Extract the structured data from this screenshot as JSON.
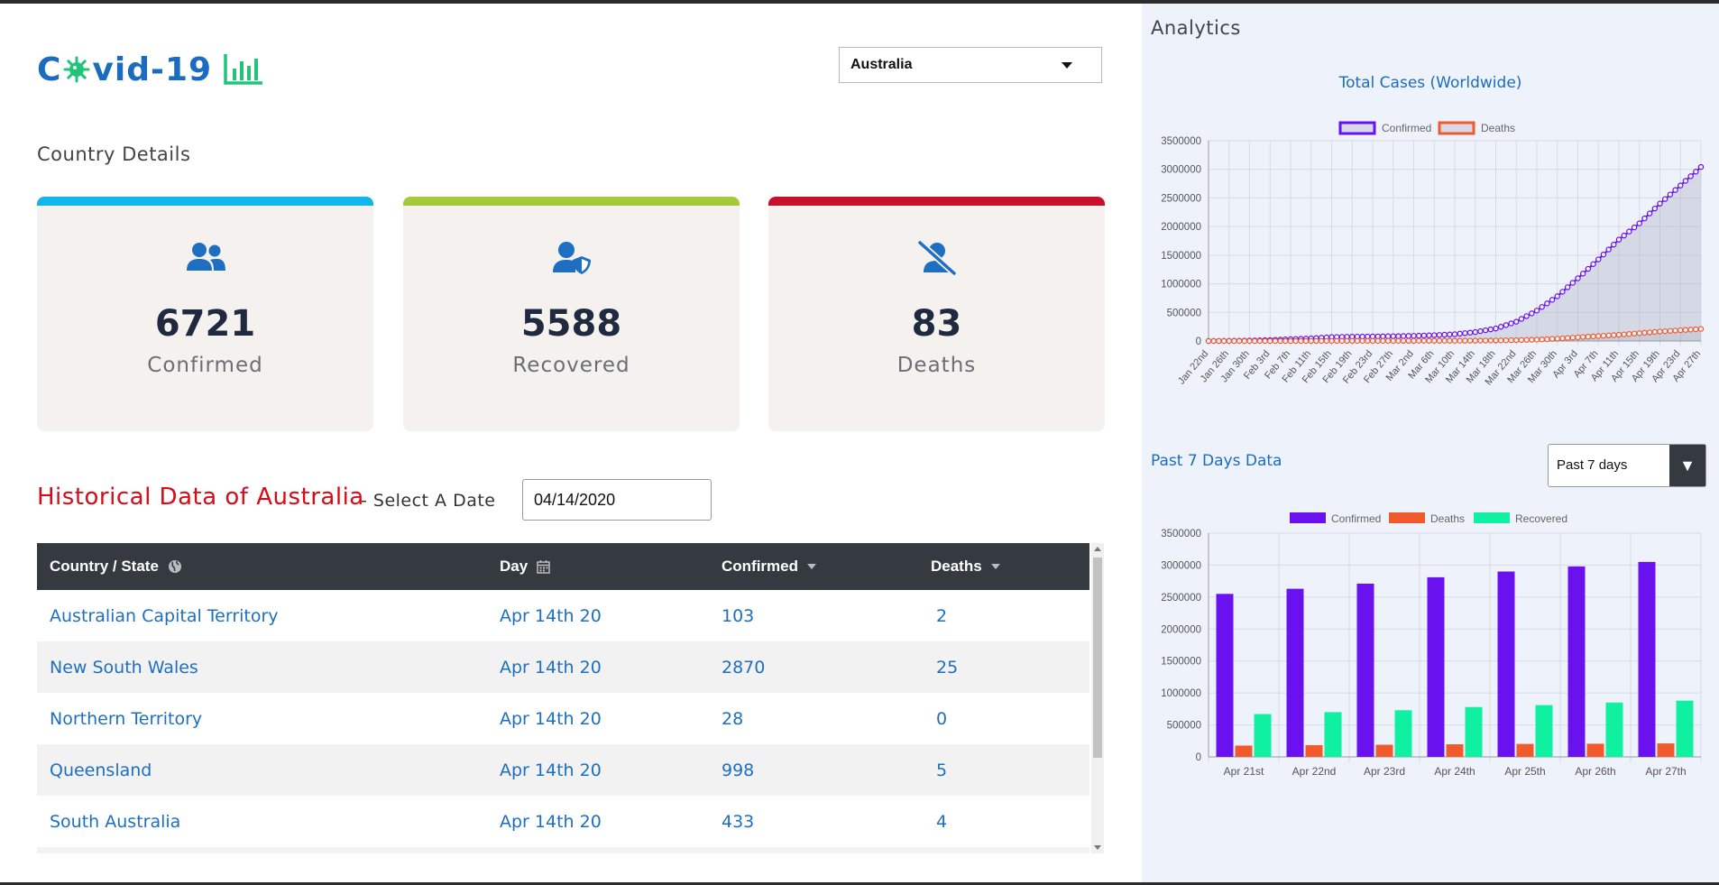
{
  "app": {
    "logo_text_pre": "C",
    "logo_text_post": "vid-19"
  },
  "country_select": {
    "selected": "Australia"
  },
  "country_details": {
    "title": "Country Details",
    "cards": [
      {
        "value": "6721",
        "label": "Confirmed",
        "accent": "#12b5ec",
        "icon": "users-icon"
      },
      {
        "value": "5588",
        "label": "Recovered",
        "accent": "#a4c93a",
        "icon": "user-shield-icon"
      },
      {
        "value": "83",
        "label": "Deaths",
        "accent": "#c8102e",
        "icon": "user-slash-icon"
      }
    ]
  },
  "historical": {
    "title": "Historical Data of Australia",
    "subtitle": "- Select A Date",
    "date_value": "04/14/2020",
    "columns": [
      "Country / State",
      "Day",
      "Confirmed",
      "Deaths"
    ],
    "rows": [
      [
        "Australian Capital Territory",
        "Apr 14th 20",
        "103",
        "2"
      ],
      [
        "New South Wales",
        "Apr 14th 20",
        "2870",
        "25"
      ],
      [
        "Northern Territory",
        "Apr 14th 20",
        "28",
        "0"
      ],
      [
        "Queensland",
        "Apr 14th 20",
        "998",
        "5"
      ],
      [
        "South Australia",
        "Apr 14th 20",
        "433",
        "4"
      ]
    ]
  },
  "analytics": {
    "title": "Analytics",
    "past_title": "Past 7 Days Data",
    "past_select": "Past 7 days"
  },
  "colors": {
    "confirmed": "#6a11f0",
    "deaths": "#f05a2c",
    "recovered": "#0ff0a0",
    "link": "#1e6fc1"
  },
  "chart_data": [
    {
      "type": "line",
      "title": "Total Cases (Worldwide)",
      "legend": [
        "Confirmed",
        "Deaths"
      ],
      "legend_position": "top",
      "ylim": [
        0,
        3500000
      ],
      "yticks": [
        0,
        500000,
        1000000,
        1500000,
        2000000,
        2500000,
        3000000,
        3500000
      ],
      "x_tick_labels": [
        "Jan 22nd",
        "Jan 26th",
        "Jan 30th",
        "Feb 3rd",
        "Feb 7th",
        "Feb 11th",
        "Feb 15th",
        "Feb 19th",
        "Feb 23rd",
        "Feb 27th",
        "Mar 2nd",
        "Mar 6th",
        "Mar 10th",
        "Mar 14th",
        "Mar 18th",
        "Mar 22nd",
        "Mar 26th",
        "Mar 30th",
        "Apr 3rd",
        "Apr 7th",
        "Apr 11th",
        "Apr 15th",
        "Apr 19th",
        "Apr 23rd",
        "Apr 27th"
      ],
      "grid": true,
      "series": [
        {
          "name": "Confirmed",
          "values": [
            555,
            2927,
            7783,
            17205,
            31532,
            45174,
            69032,
            75637,
            79356,
            84124,
            90306,
            101784,
            118592,
            156101,
            218744,
            337553,
            531769,
            782389,
            1095917,
            1426096,
            1771514,
            2056054,
            2401378,
            2717758,
            3041764
          ]
        },
        {
          "name": "Deaths",
          "values": [
            17,
            82,
            171,
            427,
            638,
            1018,
            1526,
            2122,
            2470,
            2872,
            3144,
            3460,
            4262,
            5819,
            8968,
            14652,
            24074,
            40717,
            64693,
            86687,
            108544,
            136562,
            165044,
            188315,
            211167
          ]
        }
      ]
    },
    {
      "type": "bar",
      "legend": [
        "Confirmed",
        "Deaths",
        "Recovered"
      ],
      "legend_position": "top",
      "categories": [
        "Apr 21st",
        "Apr 22nd",
        "Apr 23rd",
        "Apr 24th",
        "Apr 25th",
        "Apr 26th",
        "Apr 27th"
      ],
      "ylim": [
        0,
        3500000
      ],
      "yticks": [
        0,
        500000,
        1000000,
        1500000,
        2000000,
        2500000,
        3000000,
        3500000
      ],
      "grid": true,
      "series": [
        {
          "name": "Confirmed",
          "values": [
            2550000,
            2630000,
            2710000,
            2810000,
            2900000,
            2980000,
            3050000
          ]
        },
        {
          "name": "Deaths",
          "values": [
            177000,
            184000,
            190000,
            197000,
            203000,
            206000,
            211000
          ]
        },
        {
          "name": "Recovered",
          "values": [
            670000,
            700000,
            730000,
            780000,
            810000,
            850000,
            880000
          ]
        }
      ]
    }
  ]
}
